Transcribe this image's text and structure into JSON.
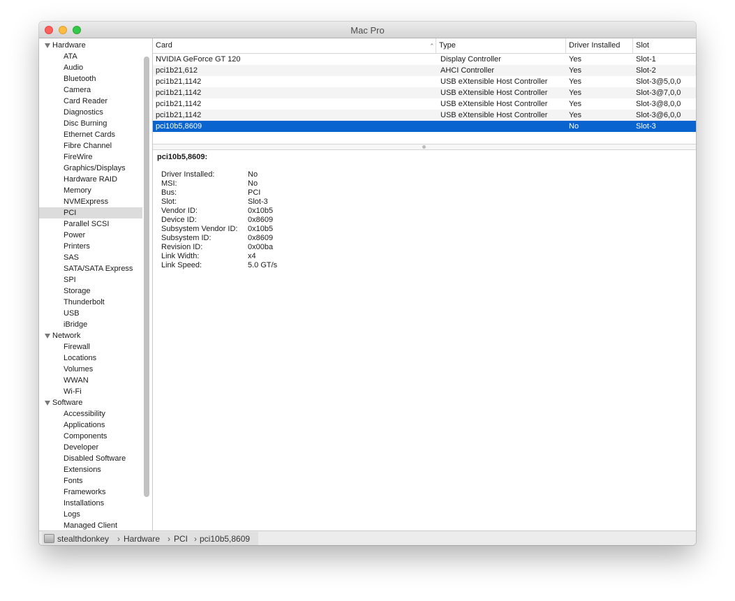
{
  "window": {
    "title": "Mac Pro"
  },
  "sidebar": {
    "groups": [
      {
        "label": "Hardware",
        "items": [
          "ATA",
          "Audio",
          "Bluetooth",
          "Camera",
          "Card Reader",
          "Diagnostics",
          "Disc Burning",
          "Ethernet Cards",
          "Fibre Channel",
          "FireWire",
          "Graphics/Displays",
          "Hardware RAID",
          "Memory",
          "NVMExpress",
          "PCI",
          "Parallel SCSI",
          "Power",
          "Printers",
          "SAS",
          "SATA/SATA Express",
          "SPI",
          "Storage",
          "Thunderbolt",
          "USB",
          "iBridge"
        ]
      },
      {
        "label": "Network",
        "items": [
          "Firewall",
          "Locations",
          "Volumes",
          "WWAN",
          "Wi-Fi"
        ]
      },
      {
        "label": "Software",
        "items": [
          "Accessibility",
          "Applications",
          "Components",
          "Developer",
          "Disabled Software",
          "Extensions",
          "Fonts",
          "Frameworks",
          "Installations",
          "Logs",
          "Managed Client"
        ]
      }
    ],
    "selected": "PCI"
  },
  "table": {
    "columns": [
      "Card",
      "Type",
      "Driver Installed",
      "Slot"
    ],
    "rows": [
      [
        "NVIDIA GeForce GT 120",
        "Display Controller",
        "Yes",
        "Slot-1"
      ],
      [
        "pci1b21,612",
        "AHCI Controller",
        "Yes",
        "Slot-2"
      ],
      [
        "pci1b21,1142",
        "USB eXtensible Host Controller",
        "Yes",
        "Slot-3@5,0,0"
      ],
      [
        "pci1b21,1142",
        "USB eXtensible Host Controller",
        "Yes",
        "Slot-3@7,0,0"
      ],
      [
        "pci1b21,1142",
        "USB eXtensible Host Controller",
        "Yes",
        "Slot-3@8,0,0"
      ],
      [
        "pci1b21,1142",
        "USB eXtensible Host Controller",
        "Yes",
        "Slot-3@6,0,0"
      ],
      [
        "pci10b5,8609",
        "",
        "No",
        "Slot-3"
      ]
    ],
    "selected_row": 6
  },
  "detail": {
    "title": "pci10b5,8609:",
    "fields": [
      {
        "label": "Driver Installed:",
        "value": "No"
      },
      {
        "label": "MSI:",
        "value": "No"
      },
      {
        "label": "Bus:",
        "value": "PCI"
      },
      {
        "label": "Slot:",
        "value": "Slot-3"
      },
      {
        "label": "Vendor ID:",
        "value": "0x10b5"
      },
      {
        "label": "Device ID:",
        "value": "0x8609"
      },
      {
        "label": "Subsystem Vendor ID:",
        "value": "0x10b5"
      },
      {
        "label": "Subsystem ID:",
        "value": "0x8609"
      },
      {
        "label": "Revision ID:",
        "value": "0x00ba"
      },
      {
        "label": "Link Width:",
        "value": "x4"
      },
      {
        "label": "Link Speed:",
        "value": "5.0 GT/s"
      }
    ]
  },
  "breadcrumb": {
    "items": [
      "stealthdonkey",
      "Hardware",
      "PCI",
      "pci10b5,8609"
    ],
    "separator": "›"
  },
  "colors": {
    "selection": "#0a64d0",
    "sidebar_selection": "#dcdcdc"
  }
}
